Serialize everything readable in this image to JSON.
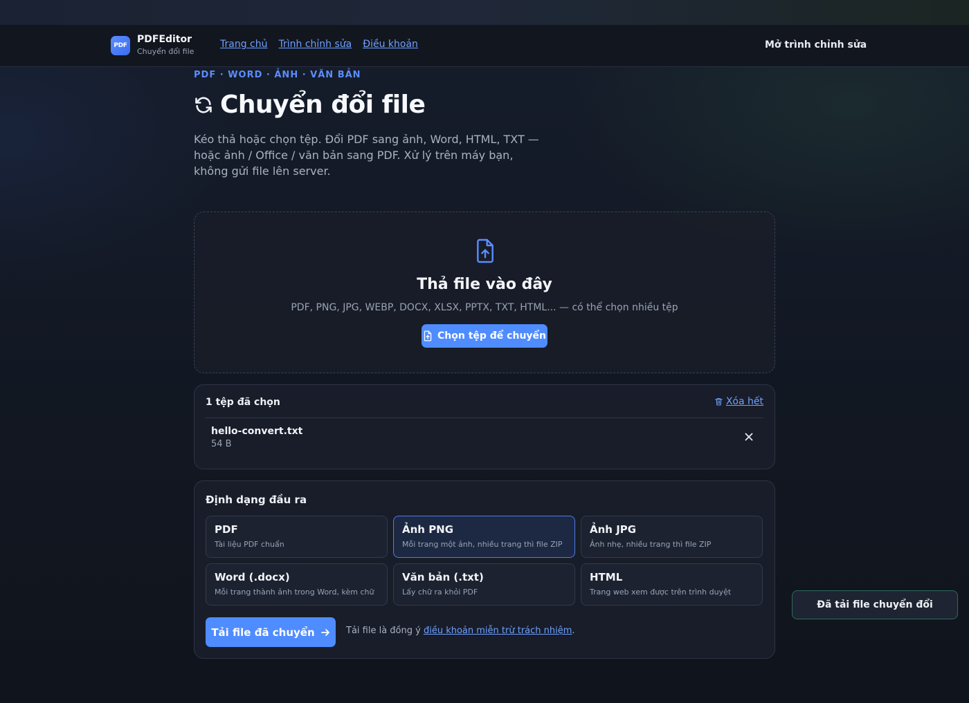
{
  "brand": {
    "logo_text": "PDF",
    "name": "PDFEditor",
    "subtitle": "Chuyển đổi file"
  },
  "nav": {
    "links": [
      "Trang chủ",
      "Trình chỉnh sửa",
      "Điều khoản"
    ],
    "open_editor": "Mở trình chỉnh sửa"
  },
  "hero": {
    "eyebrow": "PDF · WORD · ẢNH · VĂN BẢN",
    "title": "Chuyển đổi file",
    "subtitle": "Kéo thả hoặc chọn tệp. Đổi PDF sang ảnh, Word, HTML, TXT — hoặc ảnh / Office / văn bản sang PDF. Xử lý trên máy bạn, không gửi file lên server."
  },
  "dropzone": {
    "title": "Thả file vào đây",
    "hint": "PDF, PNG, JPG, WEBP, DOCX, XLSX, PPTX, TXT, HTML... — có thể chọn nhiều tệp",
    "button": "Chọn tệp để chuyển"
  },
  "files": {
    "count_label": "1 tệp đã chọn",
    "clear_all": "Xóa hết",
    "items": [
      {
        "name": "hello-convert.txt",
        "size": "54 B"
      }
    ]
  },
  "formats": {
    "heading": "Định dạng đầu ra",
    "selected": "Ảnh PNG",
    "options": [
      {
        "name": "PDF",
        "desc": "Tài liệu PDF chuẩn"
      },
      {
        "name": "Ảnh PNG",
        "desc": "Mỗi trang một ảnh, nhiều trang thì file ZIP"
      },
      {
        "name": "Ảnh JPG",
        "desc": "Ảnh nhẹ, nhiều trang thì file ZIP"
      },
      {
        "name": "Word (.docx)",
        "desc": "Mỗi trang thành ảnh trong Word, kèm chữ"
      },
      {
        "name": "Văn bản (.txt)",
        "desc": "Lấy chữ ra khỏi PDF"
      },
      {
        "name": "HTML",
        "desc": "Trang web xem được trên trình duyệt"
      }
    ]
  },
  "download": {
    "button": "Tải file đã chuyển",
    "agree_prefix": "Tải file là đồng ý",
    "agree_link": "điều khoản miễn trừ trách nhiệm",
    "agree_suffix": "."
  },
  "toast": "Đã tải file chuyển đổi",
  "colors": {
    "accent": "#4f8cff",
    "link": "#6ea0ff",
    "toast_border": "#2f6b5a"
  }
}
